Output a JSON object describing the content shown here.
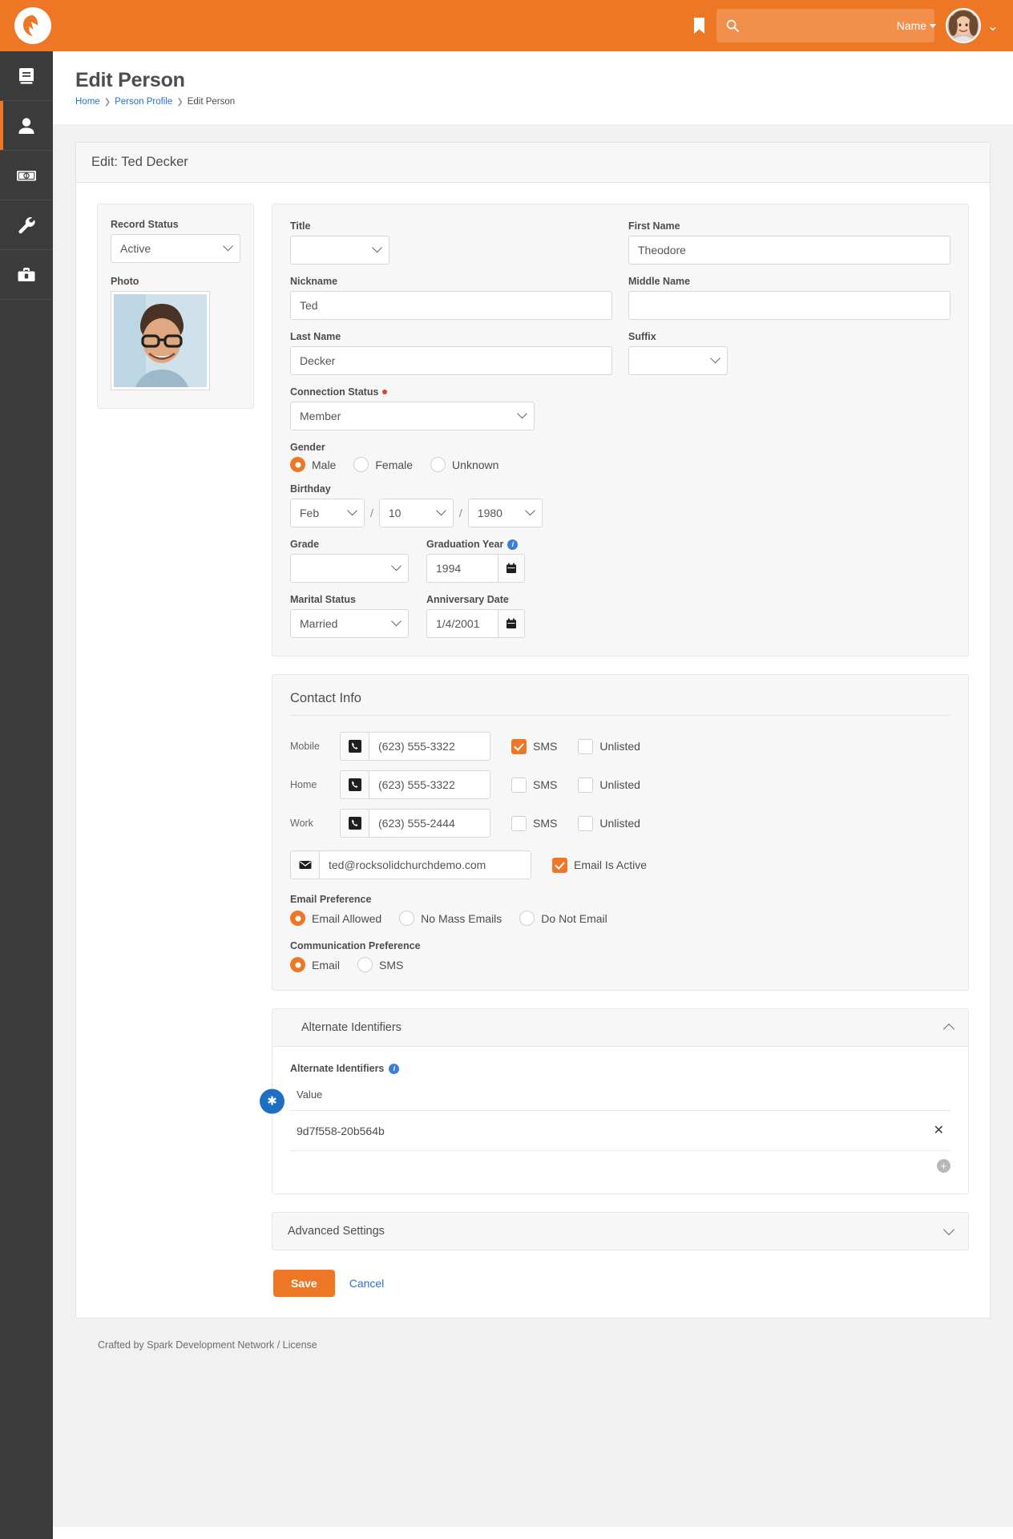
{
  "topbar": {
    "logo_name": "rock-logo",
    "bookmark_icon": "bookmark-icon",
    "search_placeholder": "",
    "search_value": "",
    "search_scope": "Name",
    "avatar_name": "user-avatar"
  },
  "sidebar": {
    "items": [
      {
        "name": "sidebar-item-cms",
        "icon": "book-icon",
        "active": false
      },
      {
        "name": "sidebar-item-people",
        "icon": "person-icon",
        "active": true
      },
      {
        "name": "sidebar-item-finance",
        "icon": "money-icon",
        "active": false
      },
      {
        "name": "sidebar-item-tools",
        "icon": "wrench-icon",
        "active": false
      },
      {
        "name": "sidebar-item-admin",
        "icon": "toolbox-icon",
        "active": false
      }
    ]
  },
  "page": {
    "title": "Edit Person",
    "breadcrumb": [
      {
        "label": "Home",
        "link": true
      },
      {
        "label": "Person Profile",
        "link": true
      },
      {
        "label": "Edit Person",
        "link": false
      }
    ]
  },
  "card": {
    "header": "Edit: Ted Decker"
  },
  "left_panel": {
    "record_status_label": "Record Status",
    "record_status_value": "Active",
    "photo_label": "Photo"
  },
  "person": {
    "title_label": "Title",
    "title_value": "",
    "first_name_label": "First Name",
    "first_name_value": "Theodore",
    "nickname_label": "Nickname",
    "nickname_value": "Ted",
    "middle_name_label": "Middle Name",
    "middle_name_value": "",
    "last_name_label": "Last Name",
    "last_name_value": "Decker",
    "suffix_label": "Suffix",
    "suffix_value": "",
    "connection_status_label": "Connection Status",
    "connection_status_value": "Member",
    "gender_label": "Gender",
    "gender_options": [
      {
        "label": "Male",
        "selected": true
      },
      {
        "label": "Female",
        "selected": false
      },
      {
        "label": "Unknown",
        "selected": false
      }
    ],
    "birthday_label": "Birthday",
    "birthday_month": "Feb",
    "birthday_day": "10",
    "birthday_year": "1980",
    "birthday_separator": "/",
    "grade_label": "Grade",
    "grade_value": "",
    "graduation_year_label": "Graduation Year",
    "graduation_year_value": "1994",
    "marital_status_label": "Marital Status",
    "marital_status_value": "Married",
    "anniversary_label": "Anniversary Date",
    "anniversary_value": "1/4/2001"
  },
  "contact": {
    "section_title": "Contact Info",
    "phones": [
      {
        "label": "Mobile",
        "value": "(623) 555-3322",
        "sms_label": "SMS",
        "sms": true,
        "unlisted_label": "Unlisted",
        "unlisted": false
      },
      {
        "label": "Home",
        "value": "(623) 555-3322",
        "sms_label": "SMS",
        "sms": false,
        "unlisted_label": "Unlisted",
        "unlisted": false
      },
      {
        "label": "Work",
        "value": "(623) 555-2444",
        "sms_label": "SMS",
        "sms": false,
        "unlisted_label": "Unlisted",
        "unlisted": false
      }
    ],
    "email_value": "ted@rocksolidchurchdemo.com",
    "email_active_label": "Email Is Active",
    "email_active": true,
    "email_pref_label": "Email Preference",
    "email_pref_options": [
      {
        "label": "Email Allowed",
        "selected": true
      },
      {
        "label": "No Mass Emails",
        "selected": false
      },
      {
        "label": "Do Not Email",
        "selected": false
      }
    ],
    "comm_pref_label": "Communication Preference",
    "comm_pref_options": [
      {
        "label": "Email",
        "selected": true
      },
      {
        "label": "SMS",
        "selected": false
      }
    ]
  },
  "alternate_identifiers": {
    "panel_title": "Alternate Identifiers",
    "field_label": "Alternate Identifiers",
    "column_header": "Value",
    "rows": [
      {
        "value": "9d7f558-20b564b"
      }
    ],
    "remove_icon": "✕",
    "add_icon": "+"
  },
  "advanced": {
    "title": "Advanced Settings"
  },
  "actions": {
    "save_label": "Save",
    "cancel_label": "Cancel"
  },
  "footer": {
    "text": "Crafted by Spark Development Network / License"
  },
  "colors": {
    "brand_orange": "#ee7725",
    "link_blue": "#2874c4",
    "sidebar_dark": "#3b3b3b",
    "required_red": "#d4442e",
    "info_blue": "#1d6fc4"
  }
}
